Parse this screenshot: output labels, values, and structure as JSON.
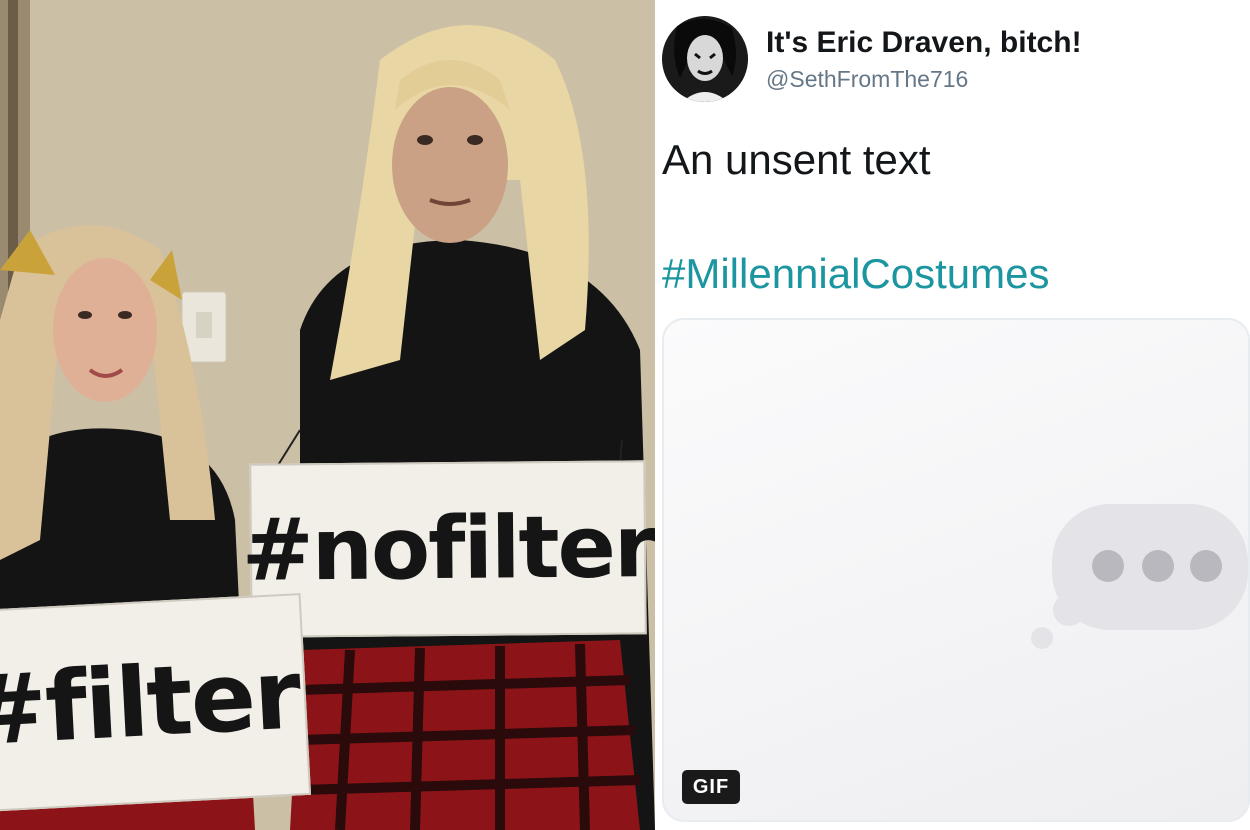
{
  "photo": {
    "sign_right": "#nofilter",
    "sign_left": "#filter"
  },
  "tweet": {
    "display_name": "It's Eric Draven, bitch!",
    "handle": "@SethFromThe716",
    "text": "An unsent text",
    "hashtag": "#MillennialCostumes",
    "media": {
      "badge": "GIF",
      "icon": "typing-indicator-bubble-icon"
    }
  },
  "colors": {
    "hashtag": "#1b95a0",
    "handle": "#657786",
    "name": "#14171a"
  }
}
